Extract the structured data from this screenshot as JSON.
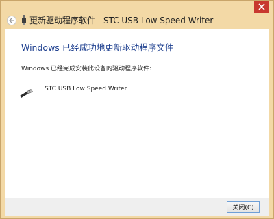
{
  "window": {
    "title": "更新驱动程序软件 - STC USB Low Speed Writer"
  },
  "main": {
    "heading": "Windows 已经成功地更新驱动程序文件",
    "description": "Windows 已经完成安装此设备的驱动程序软件:",
    "device": {
      "name": "STC USB Low Speed Writer",
      "icon": "usb-plug-icon"
    }
  },
  "footer": {
    "close_label": "关闭(C)"
  },
  "icons": {
    "titlebar_close": "close-icon",
    "back": "back-arrow-icon",
    "title_device": "usb-icon"
  },
  "colors": {
    "frame": "#f3d9a6",
    "heading": "#1d3f8f",
    "close_button": "#c8382f"
  }
}
